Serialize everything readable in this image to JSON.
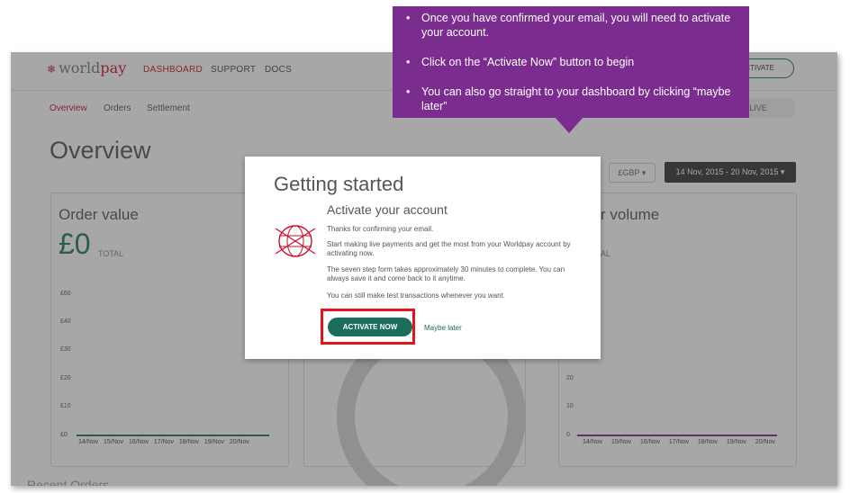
{
  "callout": {
    "bullets": [
      "Once you have confirmed your email, you will need to activate your account.",
      "Click on the “Activate Now” button to begin",
      "You can also go straight to your dashboard by clicking “maybe later”"
    ]
  },
  "topnav": {
    "logo_prefix": "world",
    "logo_suffix": "pay",
    "links": [
      "DASHBOARD",
      "SUPPORT",
      "DOCS"
    ],
    "activate_label": "ACTIVATE"
  },
  "subnav": {
    "tabs": [
      "Overview",
      "Orders",
      "Settlement"
    ],
    "live_label": "LIVE"
  },
  "main": {
    "title": "Overview",
    "currency": "£GBP",
    "date_range": "14 Nov, 2015 - 20 Nov, 2015",
    "footer_text": "Recent Orders"
  },
  "cards": {
    "order_value": {
      "title": "Order value",
      "amount": "£0",
      "amount_label": "TOTAL",
      "y_ticks": [
        "£60",
        "£40",
        "£30",
        "£20",
        "£10",
        "£0"
      ],
      "x_ticks": [
        "14/Nov",
        "15/Nov",
        "16/Nov",
        "17/Nov",
        "18/Nov",
        "19/Nov",
        "20/Nov"
      ]
    },
    "order_volume": {
      "title": "r volume",
      "amount_label": "AL",
      "y_ticks": [
        "20",
        "10",
        "0"
      ],
      "x_ticks": [
        "14/Nov",
        "15/Nov",
        "16/Nov",
        "17/Nov",
        "18/Nov",
        "19/Nov",
        "20/Nov"
      ]
    }
  },
  "modal": {
    "title": "Getting started",
    "subtitle": "Activate your account",
    "para1": "Thanks for confirming your email.",
    "para2": "Start making live payments and get the most from your Worldpay account by activating now.",
    "para3": "The seven step form takes approximately 30 minutes to complete. You can always save it and come back to it anytime.",
    "para4": "You can still make test transactions whenever you want.",
    "activate_button": "ACTIVATE NOW",
    "later_link": "Maybe later"
  },
  "colors": {
    "brand_red": "#c8102e",
    "primary_green": "#1b6e5c",
    "callout_purple": "#7b2c8f",
    "highlight_red": "#e2141c"
  }
}
